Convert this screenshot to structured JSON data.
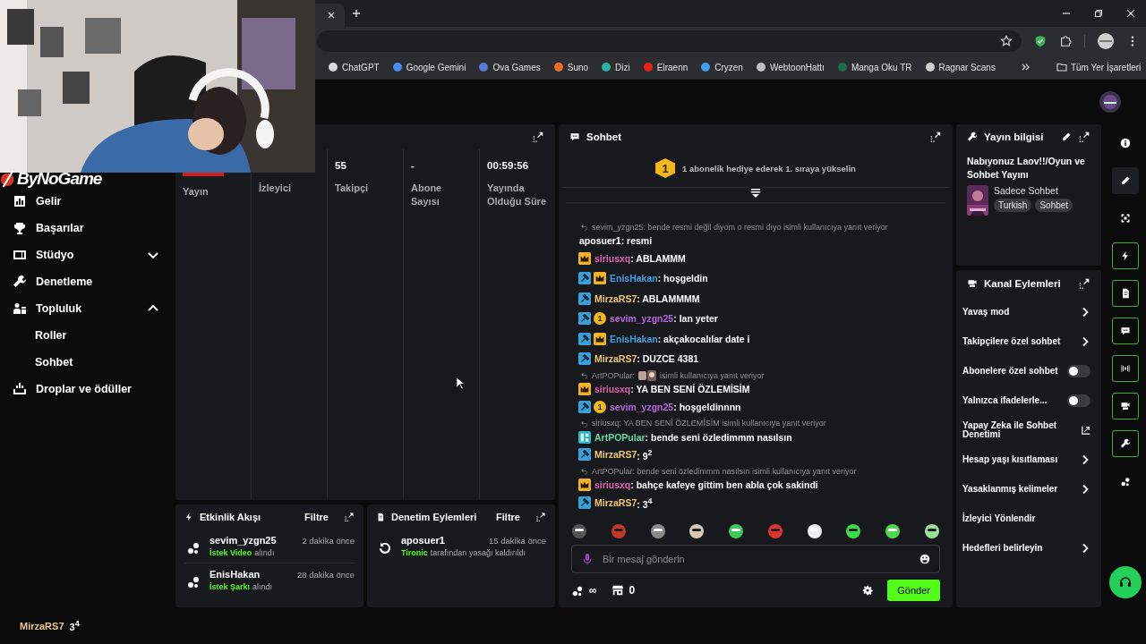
{
  "browser": {
    "bookmarks": [
      {
        "label": "ChatGPT",
        "color": "#d9d9d9"
      },
      {
        "label": "Google Gemini",
        "color": "#4a8cf0"
      },
      {
        "label": "Ova Games",
        "color": "#5a7bd6"
      },
      {
        "label": "Suno",
        "color": "#f06a2a"
      },
      {
        "label": "Dizi",
        "color": "#2ab3a0"
      },
      {
        "label": "Elraenn",
        "color": "#e62117"
      },
      {
        "label": "Cryzen",
        "color": "#3aa0e8"
      },
      {
        "label": "WebtoonHattı",
        "color": "#bfbfbf"
      },
      {
        "label": "Manga Oku TR",
        "color": "#1f6b4a"
      },
      {
        "label": "Ragnar Scans",
        "color": "#cfcfcf"
      }
    ],
    "all_bookmarks": "Tüm Yer İşaretleri"
  },
  "overlay": {
    "logo": "ByNoGame",
    "chat_user": "MirzaRS7",
    "chat_text": "3$^{4}$"
  },
  "sidebar": {
    "items": [
      {
        "label": "Gelir"
      },
      {
        "label": "Başarılar"
      },
      {
        "label": "Stüdyo",
        "expanded": false
      },
      {
        "label": "Denetleme"
      },
      {
        "label": "Topluluk",
        "expanded": true,
        "children": [
          {
            "label": "Roller"
          },
          {
            "label": "Sohbet"
          }
        ]
      },
      {
        "label": "Droplar ve ödüller"
      }
    ]
  },
  "stats": [
    {
      "label": "Yayın",
      "kind": "live"
    },
    {
      "label": "İzleyici"
    },
    {
      "value": "55",
      "label": "Takipçi"
    },
    {
      "value": "-",
      "label": "Abone Sayısı"
    },
    {
      "value": "00:59:56",
      "label": "Yayında Olduğu Süre"
    }
  ],
  "activity": {
    "title": "Etkinlik Akışı",
    "filter": "Filtre",
    "events": [
      {
        "user": "sevim_yzgn25",
        "time": "2 dakika önce",
        "highlight": "İstek Video",
        "text": "alındı"
      },
      {
        "user": "EnisHakan",
        "time": "28 dakika önce",
        "highlight": "İstek Şarkı",
        "text": "alındı"
      }
    ]
  },
  "moderation": {
    "title": "Denetim Eylemleri",
    "filter": "Filtre",
    "actions": [
      {
        "user": "aposuer1",
        "time": "15 dakika önce",
        "highlight": "Tironic",
        "text": "tarafından yasağı kaldırıldı"
      }
    ]
  },
  "chat": {
    "title": "Sohbet",
    "gift_banner": {
      "rank": "1",
      "text": "1 abonelik hediye ederek 1. sıraya yükselin"
    },
    "messages": [
      {
        "kind": "reply",
        "text": "sevim_yzgn25: bende resmi değil diyom o resmi dıyo isimli kullanıcıya yanıt veriyor"
      },
      {
        "kind": "message",
        "user": "aposuer1",
        "color": "#ffffff",
        "text": ": resmi"
      },
      {
        "kind": "message",
        "user": "siriusxq",
        "color": "#e25fae",
        "badges": [
          {
            "kind": "crown"
          }
        ],
        "text": ": ABLAMMM"
      },
      {
        "kind": "message",
        "user": "EnisHakan",
        "color": "#3f9fe6",
        "badges": [
          {
            "kind": "mod"
          },
          {
            "kind": "crown"
          }
        ],
        "text": ": hoşgeldin"
      },
      {
        "kind": "message",
        "user": "MirzaRS7",
        "color": "#f2c879",
        "badges": [
          {
            "kind": "mod"
          }
        ],
        "text": ": ABLAMMMM"
      },
      {
        "kind": "message",
        "user": "sevim_yzgn25",
        "color": "#b667e0",
        "badges": [
          {
            "kind": "mod"
          },
          {
            "kind": "sub",
            "label": "1"
          }
        ],
        "text": ": lan yeter"
      },
      {
        "kind": "message",
        "user": "EnisHakan",
        "color": "#3f9fe6",
        "badges": [
          {
            "kind": "mod"
          },
          {
            "kind": "crown"
          }
        ],
        "text": ": akçakocalılar date i"
      },
      {
        "kind": "message",
        "user": "MirzaRS7",
        "color": "#f2c879",
        "badges": [
          {
            "kind": "mod"
          }
        ],
        "text": ": DUZCE 4381"
      },
      {
        "kind": "reply",
        "text": "ArtPOPular:",
        "emote": true,
        "text_after": "isimli kullanıcıya yanıt veriyor"
      },
      {
        "kind": "message",
        "user": "siriusxq",
        "color": "#e25fae",
        "badges": [
          {
            "kind": "crown"
          }
        ],
        "text": ": YA BEN SENİ ÖZLEMİSİM"
      },
      {
        "kind": "message",
        "user": "sevim_yzgn25",
        "color": "#b667e0",
        "badges": [
          {
            "kind": "mod"
          },
          {
            "kind": "sub",
            "label": "1"
          }
        ],
        "text": ": hoşgeldinnnn"
      },
      {
        "kind": "reply",
        "text": "siriusxq: YA BEN SENİ ÖZLEMİSİM isimli kullanıcıya yanıt veriyor"
      },
      {
        "kind": "message",
        "user": "ArtPOPular",
        "color": "#5fdba8",
        "badges": [
          {
            "kind": "grid"
          }
        ],
        "text": ": bende seni özledimmm nasılsın"
      },
      {
        "kind": "message",
        "user": "MirzaRS7",
        "color": "#f2c879",
        "badges": [
          {
            "kind": "mod"
          }
        ],
        "text": ": 9$^{2}$"
      },
      {
        "kind": "reply",
        "text": "ArtPOPular: bende seni özledimmm nasılsın isimli kullanıcıya yanıt veriyor"
      },
      {
        "kind": "message",
        "user": "siriusxq",
        "color": "#e25fae",
        "badges": [
          {
            "kind": "crown"
          }
        ],
        "text": ": bahçe kafeye gittim ben abla çok sakindi"
      },
      {
        "kind": "message",
        "user": "MirzaRS7",
        "color": "#f2c879",
        "badges": [
          {
            "kind": "mod"
          }
        ],
        "text": ": 3$^{4}$"
      }
    ],
    "placeholder": "Bir mesaj gönderin",
    "points": "∞",
    "drops": "0",
    "send": "Gönder"
  },
  "stream_info": {
    "title": "Yayın bilgisi",
    "stream_title": "Nabıyonuz Laov!!/Oyun ve Sohbet Yayını",
    "category": "Sadece Sohbet",
    "tags": [
      "Turkish",
      "Sohbet"
    ]
  },
  "channel_actions": {
    "title": "Kanal Eylemleri",
    "items": [
      {
        "label": "Yavaş mod",
        "kind": "chevron"
      },
      {
        "label": "Takipçilere özel sohbet",
        "kind": "chevron"
      },
      {
        "label": "Abonelere özel sohbet",
        "kind": "toggle",
        "on": false
      },
      {
        "label": "Yalnızca ifadelerle...",
        "kind": "toggle",
        "on": false
      },
      {
        "label": "Yapay Zeka ile Sohbet Denetimi",
        "kind": "external"
      },
      {
        "label": "Hesap yaşı kısıtlaması",
        "kind": "chevron"
      },
      {
        "label": "Yasaklanmış kelimeler",
        "kind": "chevron"
      },
      {
        "label": "İzleyici Yönlendir",
        "kind": "plain"
      },
      {
        "label": "Hedefleri belirleyin",
        "kind": "chevron"
      }
    ]
  },
  "rail": [
    {
      "kind": "info",
      "on": false,
      "selected": false
    },
    {
      "kind": "pencil",
      "on": false,
      "selected": true
    },
    {
      "kind": "focus",
      "on": false,
      "selected": false
    },
    {
      "kind": "bolt",
      "on": true,
      "selected": false
    },
    {
      "kind": "doc",
      "on": true,
      "selected": false
    },
    {
      "kind": "chat",
      "on": true,
      "selected": false
    },
    {
      "kind": "broadcast",
      "on": true,
      "selected": false
    },
    {
      "kind": "video",
      "on": true,
      "selected": false
    },
    {
      "kind": "wrench",
      "on": true,
      "selected": false
    },
    {
      "kind": "dots",
      "on": false,
      "selected": false
    }
  ]
}
